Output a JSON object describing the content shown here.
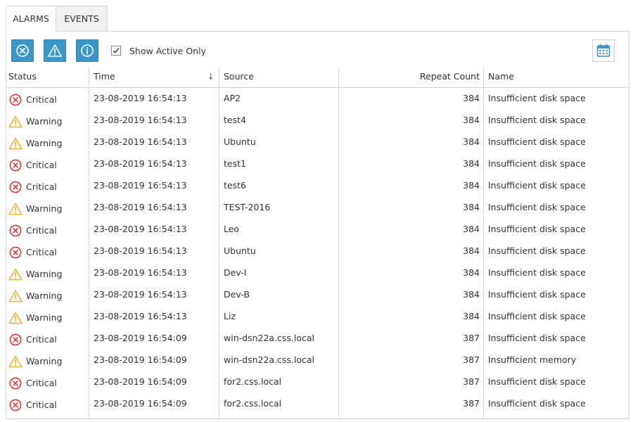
{
  "tabs": [
    {
      "label": "ALARMS",
      "active": true
    },
    {
      "label": "EVENTS",
      "active": false
    }
  ],
  "toolbar": {
    "buttons": [
      {
        "icon": "critical-filter-icon"
      },
      {
        "icon": "warning-filter-icon"
      },
      {
        "icon": "info-filter-icon"
      }
    ],
    "checkbox_label": "Show Active Only",
    "checkbox_checked": true,
    "calendar_icon": "calendar-icon",
    "accent_color": "#3a98c9"
  },
  "columns": {
    "status": "Status",
    "time": "Time",
    "time_sort": "↓",
    "source": "Source",
    "repeat_count": "Repeat Count",
    "name": "Name"
  },
  "status_colors": {
    "Critical": "#d9383a",
    "Warning": "#f0b323"
  },
  "rows": [
    {
      "status": "Critical",
      "time": "23-08-2019 16:54:13",
      "source": "AP2",
      "repeat": "384",
      "name": "Insufficient disk space"
    },
    {
      "status": "Warning",
      "time": "23-08-2019 16:54:13",
      "source": "test4",
      "repeat": "384",
      "name": "Insufficient disk space"
    },
    {
      "status": "Warning",
      "time": "23-08-2019 16:54:13",
      "source": "Ubuntu",
      "repeat": "384",
      "name": "Insufficient disk space"
    },
    {
      "status": "Critical",
      "time": "23-08-2019 16:54:13",
      "source": "test1",
      "repeat": "384",
      "name": "Insufficient disk space"
    },
    {
      "status": "Critical",
      "time": "23-08-2019 16:54:13",
      "source": "test6",
      "repeat": "384",
      "name": "Insufficient disk space"
    },
    {
      "status": "Warning",
      "time": "23-08-2019 16:54:13",
      "source": "TEST-2016",
      "repeat": "384",
      "name": "Insufficient disk space"
    },
    {
      "status": "Critical",
      "time": "23-08-2019 16:54:13",
      "source": "Leo",
      "repeat": "384",
      "name": "Insufficient disk space"
    },
    {
      "status": "Critical",
      "time": "23-08-2019 16:54:13",
      "source": "Ubuntu",
      "repeat": "384",
      "name": "Insufficient disk space"
    },
    {
      "status": "Warning",
      "time": "23-08-2019 16:54:13",
      "source": "Dev-I",
      "repeat": "384",
      "name": "Insufficient disk space"
    },
    {
      "status": "Warning",
      "time": "23-08-2019 16:54:13",
      "source": "Dev-B",
      "repeat": "384",
      "name": "Insufficient disk space"
    },
    {
      "status": "Warning",
      "time": "23-08-2019 16:54:13",
      "source": "Liz",
      "repeat": "384",
      "name": "Insufficient disk space"
    },
    {
      "status": "Critical",
      "time": "23-08-2019 16:54:09",
      "source": "win-dsn22a.css.local",
      "repeat": "387",
      "name": "Insufficient disk space"
    },
    {
      "status": "Warning",
      "time": "23-08-2019 16:54:09",
      "source": "win-dsn22a.css.local",
      "repeat": "387",
      "name": "Insufficient memory"
    },
    {
      "status": "Critical",
      "time": "23-08-2019 16:54:09",
      "source": "for2.css.local",
      "repeat": "387",
      "name": "Insufficient disk space"
    },
    {
      "status": "Critical",
      "time": "23-08-2019 16:54:09",
      "source": "for2.css.local",
      "repeat": "387",
      "name": "Insufficient disk space"
    }
  ]
}
